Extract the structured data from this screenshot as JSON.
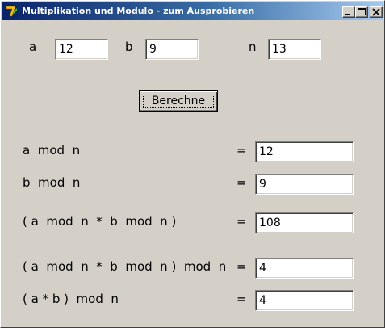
{
  "window": {
    "title": "Multiplikation und Modulo - zum Ausprobieren",
    "icon": "delphi-icon",
    "controls": [
      "minimize",
      "maximize",
      "close"
    ]
  },
  "inputs": {
    "a_label": "a",
    "a_value": "12",
    "b_label": "b",
    "b_value": "9",
    "n_label": "n",
    "n_value": "13"
  },
  "compute_button": "Berechne",
  "results": [
    {
      "label": "a  mod  n",
      "equals": "=",
      "value": "12"
    },
    {
      "label": "b  mod  n",
      "equals": "=",
      "value": "9"
    },
    {
      "label": "( a  mod  n  *  b  mod  n )",
      "equals": "=",
      "value": "108"
    },
    {
      "label": "( a  mod  n  *  b  mod  n )  mod  n",
      "equals": "=",
      "value": "4"
    },
    {
      "label": "( a * b )  mod  n",
      "equals": "=",
      "value": "4"
    }
  ]
}
